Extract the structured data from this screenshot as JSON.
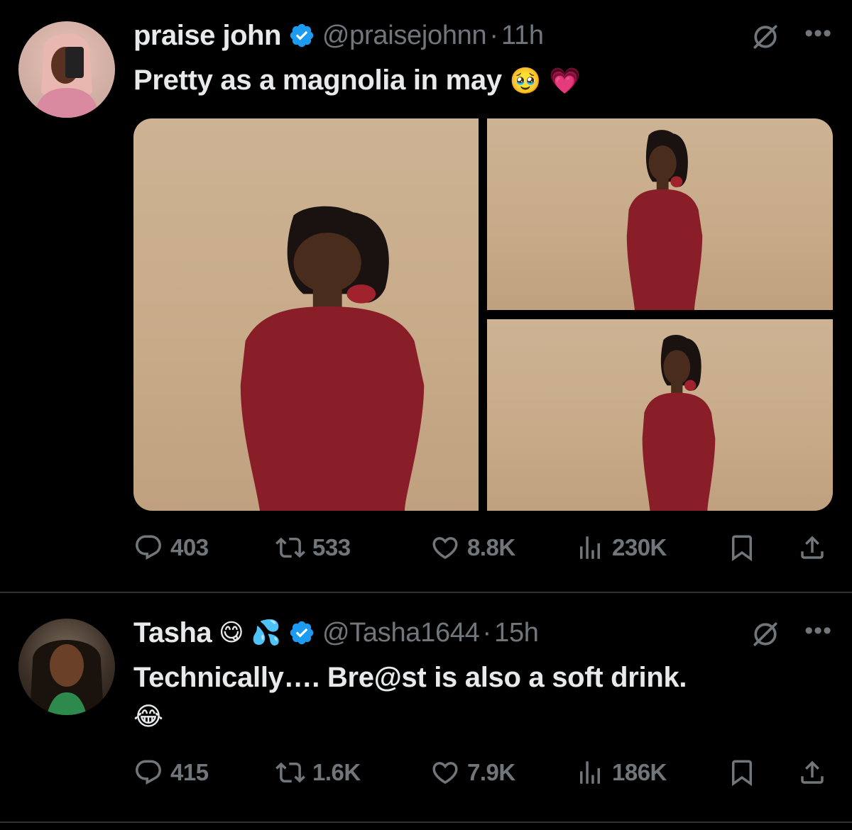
{
  "colors": {
    "background": "#000000",
    "text_primary": "#e7e9ea",
    "text_secondary": "#71767b",
    "verified_blue": "#1d9bf0",
    "divider": "#2f3336"
  },
  "tweets": [
    {
      "display_name": "praise john",
      "name_emojis": [],
      "verified": true,
      "handle": "@praisejohnn",
      "separator": "·",
      "time": "11h",
      "text": "Pretty as a magnolia in may",
      "text_emojis": [
        "🥹",
        "💗"
      ],
      "media_count": 3,
      "stats": {
        "replies": "403",
        "retweets": "533",
        "likes": "8.8K",
        "views": "230K"
      }
    },
    {
      "display_name": "Tasha",
      "name_emojis": [
        "😋",
        "💦"
      ],
      "verified": true,
      "handle": "@Tasha1644",
      "separator": "·",
      "time": "15h",
      "text": "Technically…. Bre@st is also a soft drink.",
      "text_emojis": [
        "😂"
      ],
      "media_count": 0,
      "stats": {
        "replies": "415",
        "retweets": "1.6K",
        "likes": "7.9K",
        "views": "186K"
      }
    }
  ],
  "icons": [
    "grok-icon",
    "more-icon",
    "reply-icon",
    "retweet-icon",
    "like-icon",
    "views-icon",
    "bookmark-icon",
    "share-icon",
    "verified-badge-icon"
  ]
}
